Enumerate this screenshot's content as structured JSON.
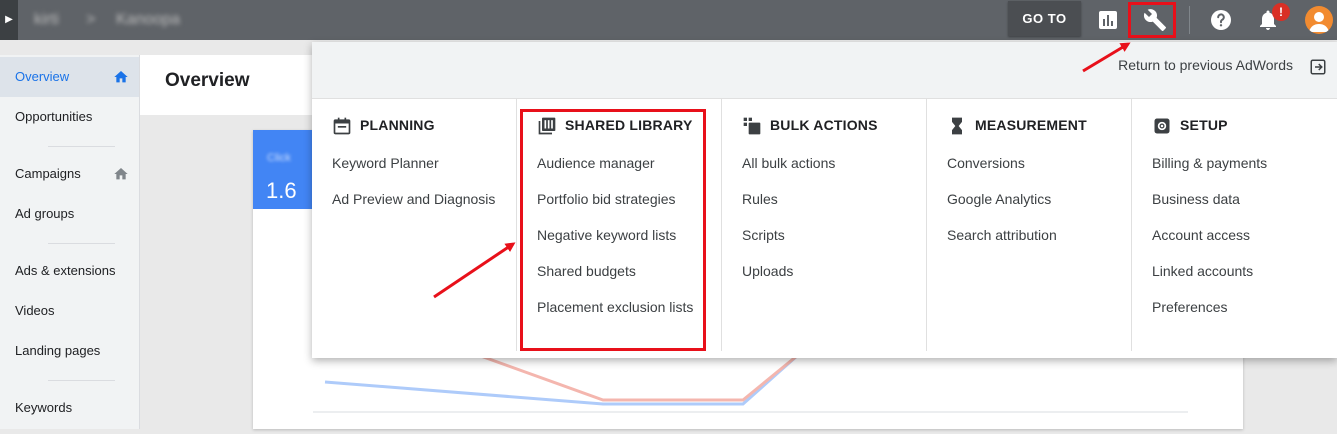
{
  "topbar": {
    "account": "kirti",
    "separator": ">",
    "sub_account": "Kanoopa",
    "goto_label": "GO TO",
    "notification_count": "!",
    "icons": [
      "reports-icon",
      "wrench-icon",
      "help-icon",
      "bell-icon",
      "avatar-icon"
    ]
  },
  "sidebar": {
    "items": [
      {
        "label": "Overview"
      },
      {
        "label": "Opportunities"
      },
      {
        "label": "Campaigns"
      },
      {
        "label": "Ad groups"
      },
      {
        "label": "Ads & extensions"
      },
      {
        "label": "Videos"
      },
      {
        "label": "Landing pages"
      },
      {
        "label": "Keywords"
      }
    ]
  },
  "main": {
    "title": "Overview",
    "card_value": "1.6"
  },
  "panel": {
    "return_label": "Return to previous AdWords",
    "columns": [
      {
        "title": "PLANNING",
        "icon": "calendar-icon",
        "items": [
          "Keyword Planner",
          "Ad Preview and Diagnosis"
        ]
      },
      {
        "title": "SHARED LIBRARY",
        "icon": "library-icon",
        "items": [
          "Audience manager",
          "Portfolio bid strategies",
          "Negative keyword lists",
          "Shared budgets",
          "Placement exclusion lists"
        ]
      },
      {
        "title": "BULK ACTIONS",
        "icon": "copy-icon",
        "items": [
          "All bulk actions",
          "Rules",
          "Scripts",
          "Uploads"
        ]
      },
      {
        "title": "MEASUREMENT",
        "icon": "hourglass-icon",
        "items": [
          "Conversions",
          "Google Analytics",
          "Search attribution"
        ]
      },
      {
        "title": "SETUP",
        "icon": "gear-icon",
        "items": [
          "Billing & payments",
          "Business data",
          "Account access",
          "Linked accounts",
          "Preferences"
        ]
      }
    ]
  },
  "colors": {
    "topbar": "#5f6368",
    "accent": "#1a73e8",
    "highlight": "#e8101a",
    "chart_blue": "#4285f4",
    "chart_red": "#ea4335"
  }
}
